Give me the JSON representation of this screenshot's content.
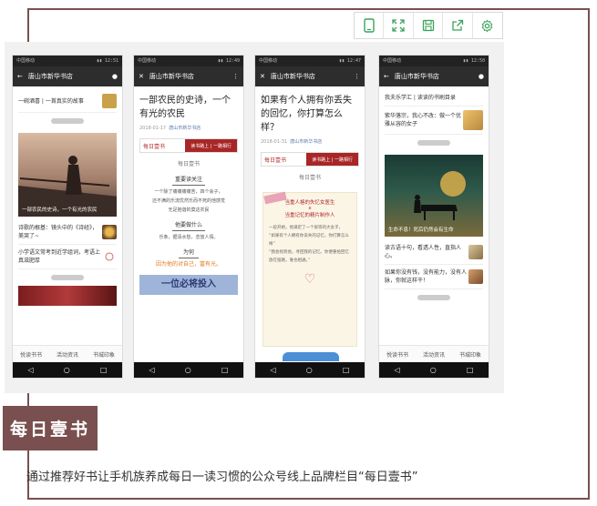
{
  "toolbar": {
    "icons": [
      "phone-preview-icon",
      "fullscreen-icon",
      "save-icon",
      "share-icon",
      "settings-icon"
    ]
  },
  "phones": [
    {
      "title": "唐山市新华书店",
      "top_text": "一碗酒喜 | 一首真实的故事",
      "hero_caption": "一部农民的史诗，一个有光的农民",
      "items": [
        {
          "text": "诗歌的根基：镜头中的《诗经》，美哭了~"
        },
        {
          "text": "小学语文常考到近学组词，考语上真滋肥厚"
        }
      ],
      "tabs": [
        "悦读书书",
        "活动资讯",
        "书城印象"
      ]
    },
    {
      "title": "唐山市新华书店",
      "article_title": "一部农民的史诗，一个有光的农民",
      "date": "2018-01-17",
      "author": "唐山市新华书店",
      "banner_left": "每日壹书",
      "banner_right": "读书路上 | 一路相行",
      "daily": "每日壹书",
      "sec1": "重要读关注",
      "lines1": [
        "一个除了痛痛痛痛苦，四个会子，",
        "还不满的乐流优然乐而不死的他感觉",
        "无足抱谐的莫这农民"
      ],
      "sec2": "他要做什么",
      "lines2": [
        "乐条，据清水愁，念放人情。"
      ],
      "sec3": "为何",
      "orange": "因为他的对自己，富有光。",
      "bottom_text": "一位必将投入"
    },
    {
      "title": "唐山市新华书店",
      "article_title": "如果有个人拥有你丢失的回忆，你打算怎么样？",
      "date": "2018-01-31",
      "author": "唐山市新华书店",
      "banner_left": "每日壹书",
      "banner_right": "读书路上 | 一路相行",
      "daily": "每日壹书",
      "card_title": "当重人格的失忆女医生",
      "card_x": "x",
      "card_sub": "当重记忆的精片制作人",
      "card_lines": [
        "一段开始，他满足了一个很等的大女子，",
        "“如果有个人拥有你丢失的记忆，你打算怎么样”",
        "“我会找到他，寻回我的记忆。你便重拾回忆",
        "放在留路，谁也相通。”"
      ]
    },
    {
      "title": "唐山市新华书店",
      "top_text": "我夫乐学汇 | 读读的书刷目录",
      "item_top": {
        "text": "紫华落宗，我心不改：做一个优雅从容的女子"
      },
      "hero_caption": "生命不息！死后仍然会有生命",
      "items": [
        {
          "text": "读古语十句，看透人性，直指人心。"
        },
        {
          "text": "如果你没有钱，没有能力，没有人脉，你就这样干！"
        }
      ],
      "tabs": [
        "悦读书书",
        "活动资讯",
        "书城印象"
      ]
    }
  ],
  "badge": "每日壹书",
  "caption": "通过推荐好书让手机族养成每日一读习惯的公众号线上品牌栏目“每日壹书”",
  "colors": {
    "frame": "#7a4f4f",
    "toolbar_icon": "#3aa35a",
    "banner_red": "#a92626"
  }
}
